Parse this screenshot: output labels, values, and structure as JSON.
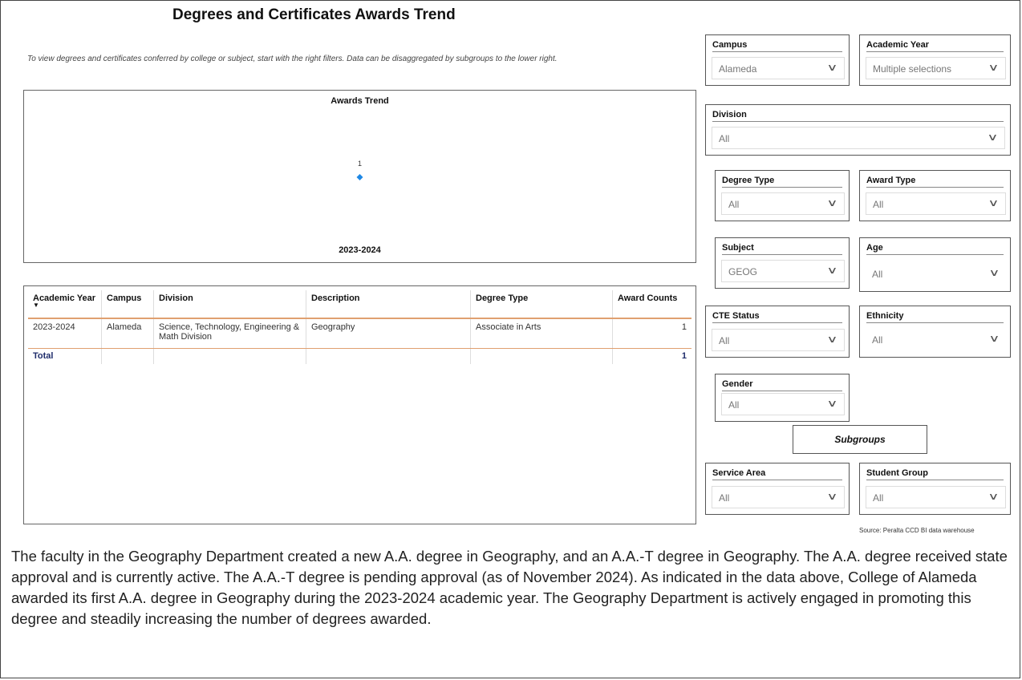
{
  "report": {
    "title": "Degrees and Certificates Awards Trend",
    "subtitle": "To view degrees and certificates conferred by college or subject, start with the right filters. Data can be disaggregated by subgroups to the lower right."
  },
  "chart_data": {
    "type": "line",
    "title": "Awards Trend",
    "x": [
      "2023-2024"
    ],
    "series": [
      {
        "values": [
          1
        ]
      }
    ],
    "data_labels": [
      "1"
    ],
    "marker_color": "#1f88e5"
  },
  "table": {
    "headers": [
      "Academic Year",
      "Campus",
      "Division",
      "Description",
      "Degree Type",
      "Award Counts"
    ],
    "rows": [
      [
        "2023-2024",
        "Alameda",
        "Science, Technology, Engineering & Math Division",
        "Geography",
        "Associate in Arts",
        "1"
      ]
    ],
    "total_label": "Total",
    "total_value": "1"
  },
  "filters": {
    "campus": {
      "label": "Campus",
      "value": "Alameda"
    },
    "academic_year": {
      "label": "Academic Year",
      "value": "Multiple selections"
    },
    "division": {
      "label": "Division",
      "value": "All"
    },
    "degree_type": {
      "label": "Degree Type",
      "value": "All"
    },
    "award_type": {
      "label": "Award Type",
      "value": "All"
    },
    "subject": {
      "label": "Subject",
      "value": "GEOG"
    },
    "age": {
      "label": "Age",
      "value": "All"
    },
    "cte_status": {
      "label": "CTE Status",
      "value": "All"
    },
    "ethnicity": {
      "label": "Ethnicity",
      "value": "All"
    },
    "gender": {
      "label": "Gender",
      "value": "All"
    },
    "service_area": {
      "label": "Service Area",
      "value": "All"
    },
    "student_group": {
      "label": "Student Group",
      "value": "All"
    }
  },
  "subgroups_label": "Subgroups",
  "source": "Source: Peralta CCD BI data warehouse",
  "narrative": "The faculty in the Geography Department created a new A.A. degree in Geography, and an A.A.-T degree in Geography. The A.A. degree received state approval and is currently active. The A.A.-T degree is pending approval (as of November 2024). As indicated in the data above, College of Alameda awarded its first A.A. degree in Geography during the 2023-2024 academic year. The Geography Department is actively engaged in promoting this degree and steadily increasing the number of degrees awarded."
}
